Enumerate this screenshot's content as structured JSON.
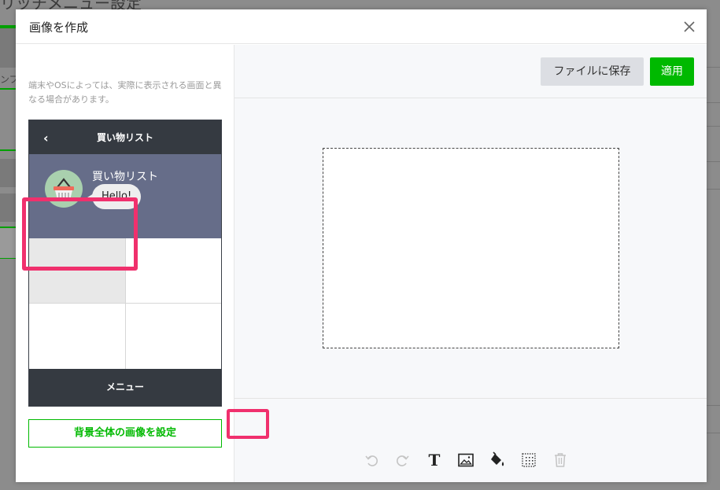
{
  "background_page": {
    "title": "リッチメニュー設定",
    "side_label": "ンプ"
  },
  "modal": {
    "title": "画像を作成",
    "close_icon": "close-icon"
  },
  "left_panel": {
    "notice": "端末やOSによっては、実際に表示される画面と異なる場合があります。",
    "phone": {
      "back_icon": "chevron-left-icon",
      "back_symbol": "‹",
      "header_title": "買い物リスト",
      "chat_name": "買い物リスト",
      "bubble_text": "Hello!",
      "footer_label": "メニュー"
    },
    "set_background_button": "背景全体の画像を設定"
  },
  "right_panel": {
    "save_button": "ファイルに保存",
    "apply_button": "適用",
    "tools": [
      {
        "name": "undo-icon"
      },
      {
        "name": "redo-icon"
      },
      {
        "name": "text-icon",
        "symbol": "T"
      },
      {
        "name": "image-icon"
      },
      {
        "name": "fill-icon"
      },
      {
        "name": "grid-icon"
      },
      {
        "name": "trash-icon"
      }
    ]
  },
  "colors": {
    "accent": "#00b900",
    "highlight": "#f0306d",
    "phone_dark": "#353a41",
    "chat_bg": "#666d89"
  }
}
